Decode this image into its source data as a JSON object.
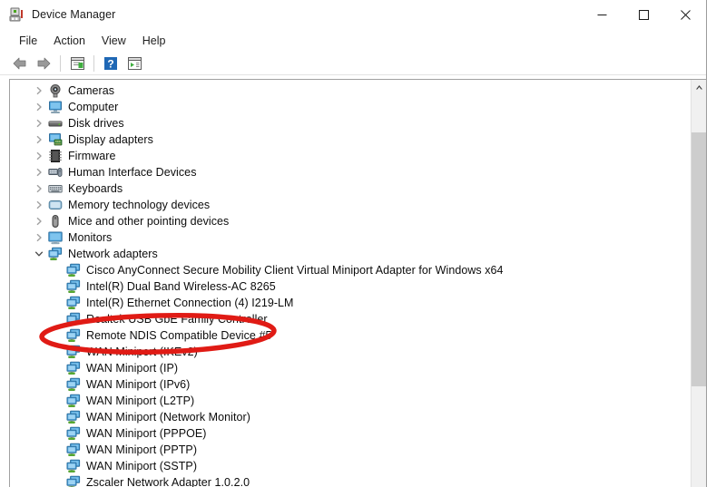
{
  "window": {
    "title": "Device Manager",
    "icon": "device-manager-icon",
    "controls": {
      "minimize": "Minimize",
      "maximize": "Maximize",
      "close": "Close"
    }
  },
  "menubar": {
    "items": [
      {
        "label": "File"
      },
      {
        "label": "Action"
      },
      {
        "label": "View"
      },
      {
        "label": "Help"
      }
    ]
  },
  "toolbar": {
    "buttons": [
      {
        "name": "back-button",
        "icon": "arrow-left-icon",
        "label": "Back"
      },
      {
        "name": "forward-button",
        "icon": "arrow-right-icon",
        "label": "Forward"
      },
      {
        "name": "properties-button",
        "icon": "properties-icon",
        "label": "Properties"
      },
      {
        "name": "help-button",
        "icon": "help-question-icon",
        "label": "Help"
      },
      {
        "name": "show-hidden-devices-button",
        "icon": "show-hidden-icon",
        "label": "Show hidden devices"
      }
    ]
  },
  "tree": {
    "items": [
      {
        "label": "Cameras",
        "level": 0,
        "expanded": false,
        "icon": "camera-icon"
      },
      {
        "label": "Computer",
        "level": 0,
        "expanded": false,
        "icon": "computer-icon"
      },
      {
        "label": "Disk drives",
        "level": 0,
        "expanded": false,
        "icon": "disk-drive-icon"
      },
      {
        "label": "Display adapters",
        "level": 0,
        "expanded": false,
        "icon": "display-adapter-icon"
      },
      {
        "label": "Firmware",
        "level": 0,
        "expanded": false,
        "icon": "firmware-chip-icon"
      },
      {
        "label": "Human Interface Devices",
        "level": 0,
        "expanded": false,
        "icon": "hid-icon"
      },
      {
        "label": "Keyboards",
        "level": 0,
        "expanded": false,
        "icon": "keyboard-icon"
      },
      {
        "label": "Memory technology devices",
        "level": 0,
        "expanded": false,
        "icon": "memory-device-icon"
      },
      {
        "label": "Mice and other pointing devices",
        "level": 0,
        "expanded": false,
        "icon": "mouse-icon"
      },
      {
        "label": "Monitors",
        "level": 0,
        "expanded": false,
        "icon": "monitor-icon"
      },
      {
        "label": "Network adapters",
        "level": 0,
        "expanded": true,
        "icon": "network-adapter-icon"
      },
      {
        "label": "Cisco AnyConnect Secure Mobility Client Virtual Miniport Adapter for Windows x64",
        "level": 1,
        "icon": "network-adapter-icon"
      },
      {
        "label": "Intel(R) Dual Band Wireless-AC 8265",
        "level": 1,
        "icon": "network-adapter-icon"
      },
      {
        "label": "Intel(R) Ethernet Connection (4) I219-LM",
        "level": 1,
        "icon": "network-adapter-icon"
      },
      {
        "label": "Realtek USB GbE Family Controller",
        "level": 1,
        "icon": "network-adapter-icon"
      },
      {
        "label": "Remote NDIS Compatible Device #5",
        "level": 1,
        "icon": "network-adapter-icon",
        "highlighted": true
      },
      {
        "label": "WAN Miniport (IKEv2)",
        "level": 1,
        "icon": "network-adapter-icon"
      },
      {
        "label": "WAN Miniport (IP)",
        "level": 1,
        "icon": "network-adapter-icon"
      },
      {
        "label": "WAN Miniport (IPv6)",
        "level": 1,
        "icon": "network-adapter-icon"
      },
      {
        "label": "WAN Miniport (L2TP)",
        "level": 1,
        "icon": "network-adapter-icon"
      },
      {
        "label": "WAN Miniport (Network Monitor)",
        "level": 1,
        "icon": "network-adapter-icon"
      },
      {
        "label": "WAN Miniport (PPPOE)",
        "level": 1,
        "icon": "network-adapter-icon"
      },
      {
        "label": "WAN Miniport (PPTP)",
        "level": 1,
        "icon": "network-adapter-icon"
      },
      {
        "label": "WAN Miniport (SSTP)",
        "level": 1,
        "icon": "network-adapter-icon"
      },
      {
        "label": "Zscaler Network Adapter 1.0.2.0",
        "level": 1,
        "icon": "network-adapter-icon"
      }
    ]
  },
  "annotation": {
    "shape": "ellipse",
    "color": "#e01b15",
    "targets": "Remote NDIS Compatible Device #5"
  },
  "scrollbar": {
    "up_arrow": "scroll-up-icon",
    "thumb": "scroll-thumb"
  },
  "colors": {
    "accent_red": "#e01b15",
    "icon_blue": "#3f9ae0",
    "icon_green": "#5ab52d",
    "text": "#0c0c0c"
  }
}
